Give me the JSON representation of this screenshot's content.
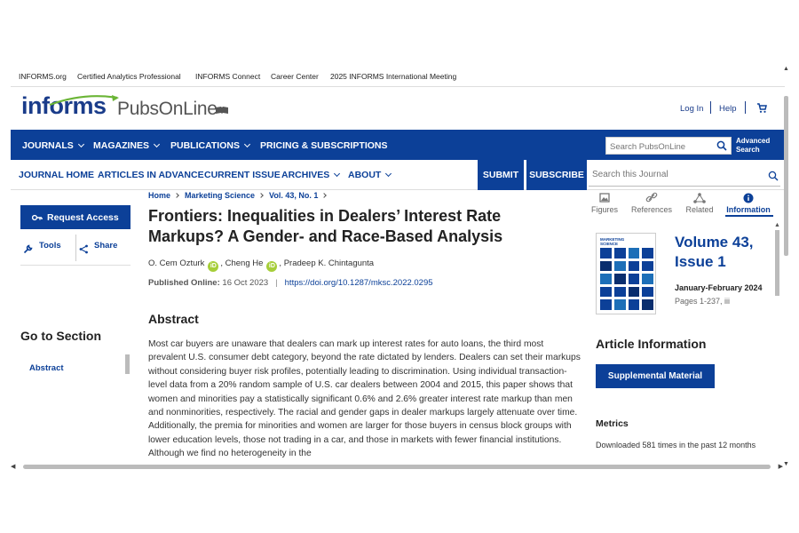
{
  "util_links": [
    "INFORMS.org",
    "Certified Analytics Professional",
    "INFORMS Connect",
    "Career Center",
    "2025 INFORMS International Meeting"
  ],
  "logo": {
    "brand": "informs",
    "product": "PubsOnLine"
  },
  "account": {
    "login": "Log In",
    "help": "Help"
  },
  "main_nav": {
    "items": [
      "JOURNALS",
      "MAGAZINES",
      "PUBLICATIONS",
      "PRICING & SUBSCRIPTIONS"
    ],
    "search_placeholder": "Search PubsOnLine",
    "advanced_search": [
      "Advanced",
      "Search"
    ]
  },
  "journal_nav": {
    "items": [
      "JOURNAL HOME",
      "ARTICLES IN ADVANCE",
      "CURRENT ISSUE",
      "ARCHIVES",
      "ABOUT"
    ],
    "submit": "SUBMIT",
    "subscribe": "SUBSCRIBE",
    "search_placeholder": "Search this Journal"
  },
  "sidebar": {
    "request_access": "Request Access",
    "tools": "Tools",
    "share": "Share",
    "goto_section": "Go to Section",
    "sections": [
      "Abstract"
    ]
  },
  "breadcrumb": [
    "Home",
    "Marketing Science",
    "Vol. 43, No. 1"
  ],
  "article": {
    "title": "Frontiers: Inequalities in Dealers’ Interest Rate Markups? A Gender- and Race-Based Analysis",
    "authors": [
      "O. Cem Ozturk",
      "Cheng He",
      "Pradeep K. Chintagunta"
    ],
    "published_label": "Published Online:",
    "published_date": "16 Oct 2023",
    "doi": "https://doi.org/10.1287/mksc.2022.0295",
    "abstract_heading": "Abstract",
    "abstract": "Most car buyers are unaware that dealers can mark up interest rates for auto loans, the third most prevalent U.S. consumer debt category, beyond the rate dictated by lenders. Dealers can set their markups without considering buyer risk profiles, potentially leading to discrimination. Using individual transaction-level data from a 20% random sample of U.S. car dealers between 2004 and 2015, this paper shows that women and minorities pay a statistically significant 0.6% and 2.6% greater interest rate markup than men and nonminorities, respectively. The racial and gender gaps in dealer markups largely attenuate over time. Additionally, the premia for minorities and women are larger for those buyers in census block groups with lower education levels, those not trading in a car, and those in markets with fewer financial institutions. Although we find no heterogeneity in the"
  },
  "right_tabs": [
    {
      "label": "Figures",
      "icon": "image-icon"
    },
    {
      "label": "References",
      "icon": "link-icon"
    },
    {
      "label": "Related",
      "icon": "network-icon"
    },
    {
      "label": "Information",
      "icon": "info-icon",
      "active": true
    }
  ],
  "issue": {
    "cover_title": [
      "MARKETING",
      "SCIENCE"
    ],
    "volume": "Volume 43, Issue 1",
    "date": "January-February 2024",
    "pages": "Pages 1-237, iii"
  },
  "article_info": {
    "heading": "Article Information",
    "supplemental": "Supplemental Material",
    "metrics_heading": "Metrics",
    "downloads": "Downloaded 581 times in the past 12 months"
  },
  "colors": {
    "brand_blue": "#0c4098",
    "orcid_green": "#a6ce39"
  }
}
